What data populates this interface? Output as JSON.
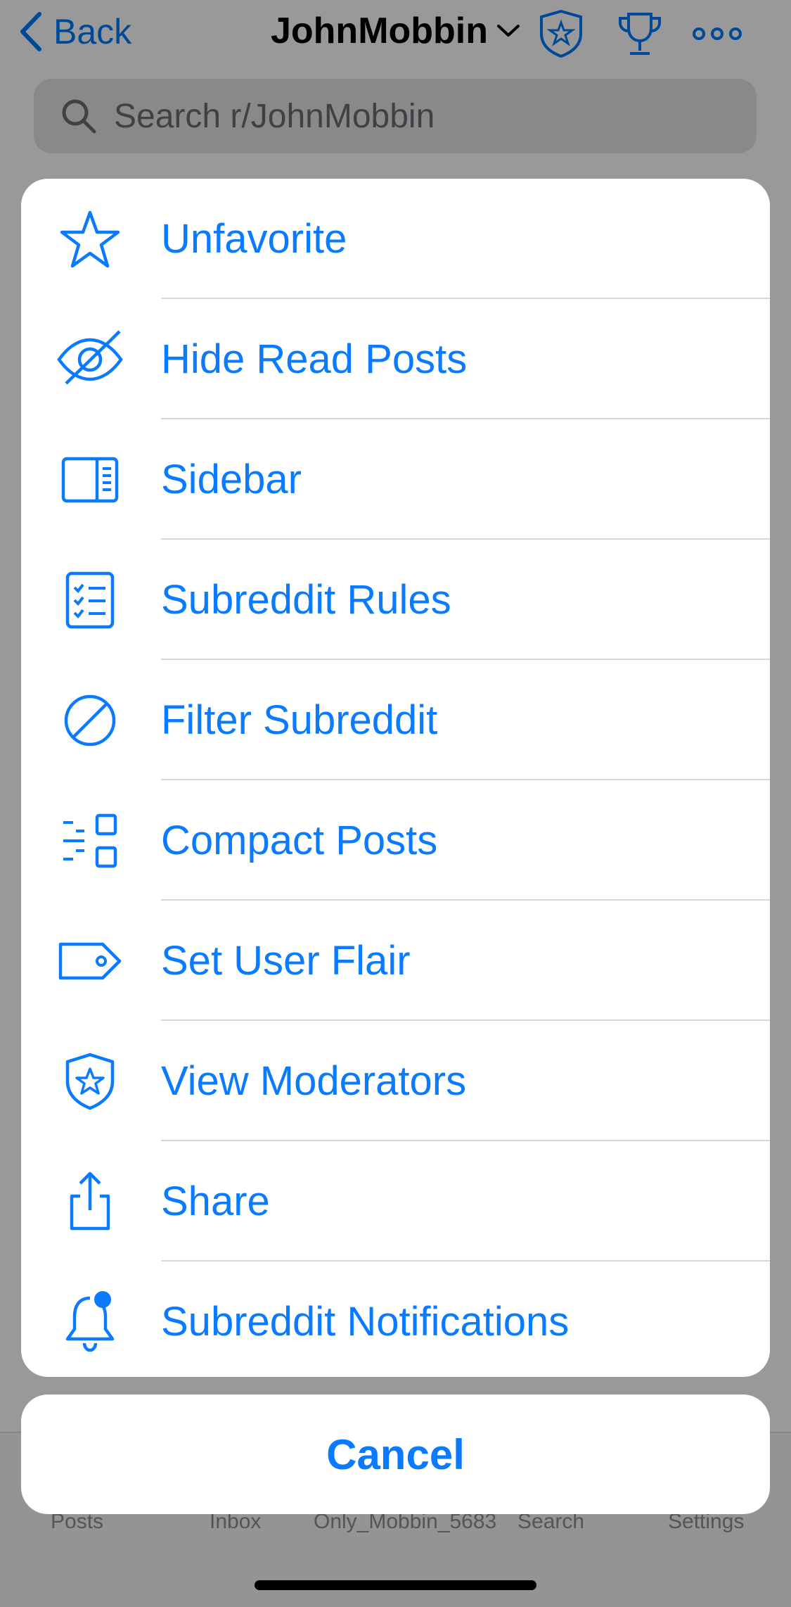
{
  "nav": {
    "back_label": "Back",
    "title": "JohnMobbin",
    "icons": [
      "shield-star-icon",
      "trophy-icon",
      "more-icon"
    ]
  },
  "search": {
    "placeholder": "Search r/JohnMobbin"
  },
  "tabbar": {
    "tabs": [
      "Posts",
      "Inbox",
      "Only_Mobbin_5683",
      "Search",
      "Settings"
    ]
  },
  "menu": {
    "items": [
      {
        "label": "Unfavorite",
        "icon": "star-icon"
      },
      {
        "label": "Hide Read Posts",
        "icon": "eye-slash-icon"
      },
      {
        "label": "Sidebar",
        "icon": "sidebar-icon"
      },
      {
        "label": "Subreddit Rules",
        "icon": "checklist-icon"
      },
      {
        "label": "Filter Subreddit",
        "icon": "prohibited-icon"
      },
      {
        "label": "Compact Posts",
        "icon": "compact-list-icon"
      },
      {
        "label": "Set User Flair",
        "icon": "tag-icon"
      },
      {
        "label": "View Moderators",
        "icon": "shield-star-icon"
      },
      {
        "label": "Share",
        "icon": "share-icon"
      },
      {
        "label": "Subreddit Notifications",
        "icon": "bell-badge-icon"
      }
    ],
    "cancel_label": "Cancel"
  },
  "colors": {
    "accent": "#0a7aff",
    "dim": "#000000"
  }
}
